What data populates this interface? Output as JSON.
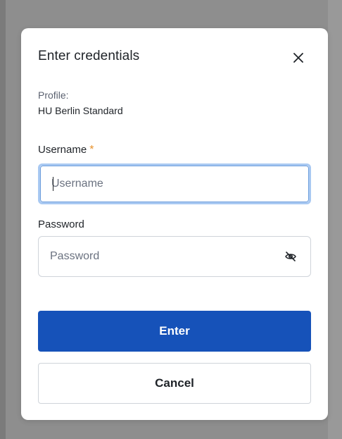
{
  "dialog": {
    "title": "Enter credentials",
    "close_icon": "close-icon",
    "profile_label": "Profile:",
    "profile_value": "HU Berlin Standard"
  },
  "form": {
    "username": {
      "label": "Username",
      "required_mark": "*",
      "value": "",
      "placeholder": "Username"
    },
    "password": {
      "label": "Password",
      "value": "",
      "placeholder": "Password",
      "toggle_icon": "eye-off-icon"
    }
  },
  "actions": {
    "submit_label": "Enter",
    "cancel_label": "Cancel"
  },
  "colors": {
    "primary": "#1652b9",
    "required": "#e8922c",
    "focus_ring": "#a9c9f2",
    "border": "#cfd4da"
  }
}
